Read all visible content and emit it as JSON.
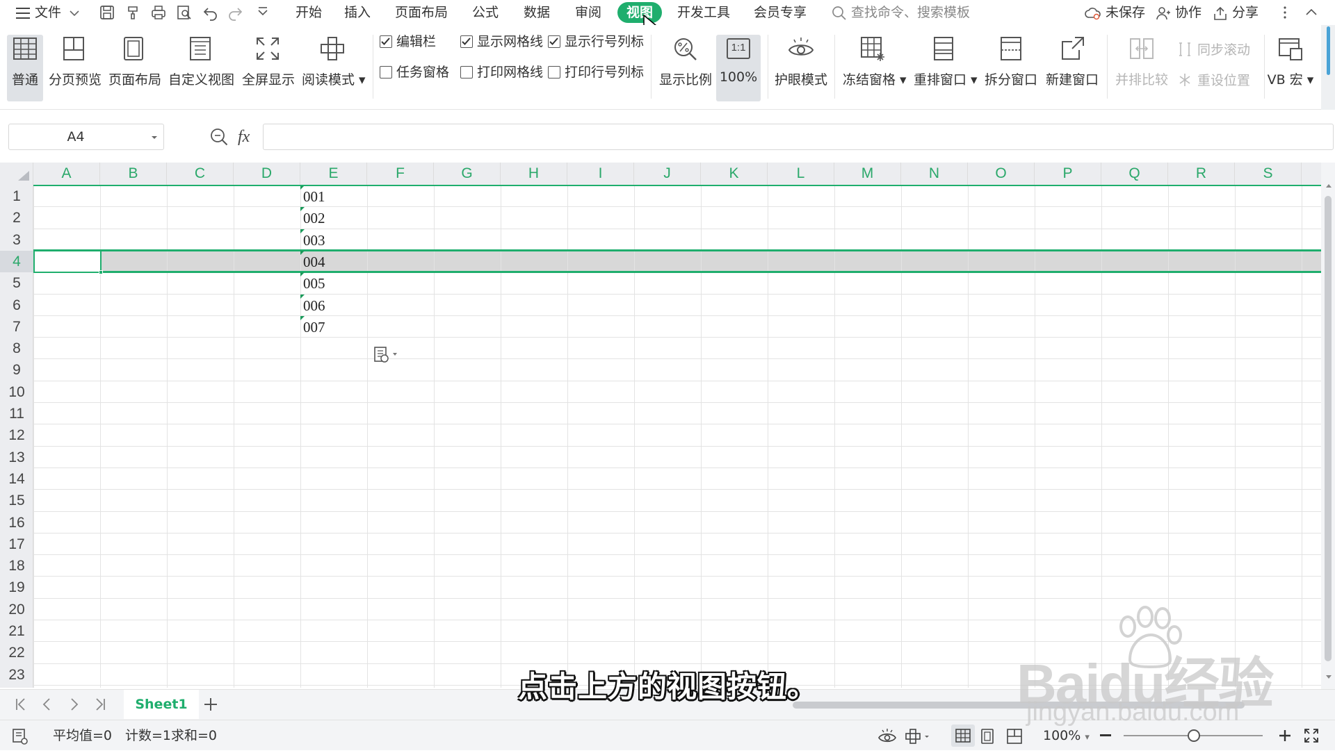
{
  "colors": {
    "accent": "#1fae6d",
    "header_text": "#2aa86a",
    "row_highlight": "#d8d8d8",
    "grid": "#dcdcdc"
  },
  "menu": {
    "hamburger_icon": "hamburger-icon",
    "file_label": "文件",
    "tabs": [
      {
        "label": "开始"
      },
      {
        "label": "插入"
      },
      {
        "label": "页面布局"
      },
      {
        "label": "公式"
      },
      {
        "label": "数据"
      },
      {
        "label": "审阅"
      },
      {
        "label": "视图",
        "active": true
      },
      {
        "label": "开发工具"
      },
      {
        "label": "会员专享"
      }
    ],
    "search_placeholder": "查找命令、搜索模板",
    "unsaved": "未保存",
    "collab": "协作",
    "share": "分享"
  },
  "ribbon": {
    "normal": "普通",
    "page_break": "分页预览",
    "page_layout": "页面布局",
    "custom_view": "自定义视图",
    "full_screen": "全屏显示",
    "read_mode": "阅读模式",
    "checkboxes": {
      "formula_bar": {
        "label": "编辑栏",
        "checked": true
      },
      "task_pane": {
        "label": "任务窗格",
        "checked": false
      },
      "show_gridlines": {
        "label": "显示网格线",
        "checked": true
      },
      "print_gridlines": {
        "label": "打印网格线",
        "checked": false
      },
      "show_headers": {
        "label": "显示行号列标",
        "checked": true
      },
      "print_headers": {
        "label": "打印行号列标",
        "checked": false
      }
    },
    "zoom": "显示比例",
    "zoom_100": "100%",
    "zoom_100_icon_text": "1:1",
    "eye_mode": "护眼模式",
    "freeze": "冻结窗格",
    "arrange": "重排窗口",
    "split": "拆分窗口",
    "new_window": "新建窗口",
    "side_by_side": "并排比较",
    "sync_scroll": "同步滚动",
    "reset_position": "重设位置",
    "vb_macro": "VB 宏"
  },
  "formula_bar": {
    "name_box": "A4",
    "fx": "fx",
    "formula": ""
  },
  "grid": {
    "columns": [
      "A",
      "B",
      "C",
      "D",
      "E",
      "F",
      "G",
      "H",
      "I",
      "J",
      "K",
      "L",
      "M",
      "N",
      "O",
      "P",
      "Q",
      "R",
      "S"
    ],
    "rows": [
      "1",
      "2",
      "3",
      "4",
      "5",
      "6",
      "7",
      "8",
      "9",
      "10",
      "11",
      "12",
      "13",
      "14",
      "15",
      "16",
      "17",
      "18",
      "19",
      "20",
      "21",
      "22",
      "23"
    ],
    "selected_row": "4",
    "selected_cell": "A4",
    "cells": [
      {
        "col": "E",
        "row": "1",
        "value": "001"
      },
      {
        "col": "E",
        "row": "2",
        "value": "002"
      },
      {
        "col": "E",
        "row": "3",
        "value": "003"
      },
      {
        "col": "E",
        "row": "4",
        "value": "004"
      },
      {
        "col": "E",
        "row": "5",
        "value": "005"
      },
      {
        "col": "E",
        "row": "6",
        "value": "006"
      },
      {
        "col": "E",
        "row": "7",
        "value": "007"
      }
    ]
  },
  "sheets": {
    "tabs": [
      {
        "label": "Sheet1",
        "active": true
      }
    ]
  },
  "status": {
    "average": "平均值=0",
    "count": "计数=1",
    "sum": "求和=0",
    "zoom": "100%"
  },
  "subtitle": "点击上方的视图按钮。",
  "watermark": {
    "brand": "Baidu经验",
    "url": "jingyan.baidu.com"
  }
}
